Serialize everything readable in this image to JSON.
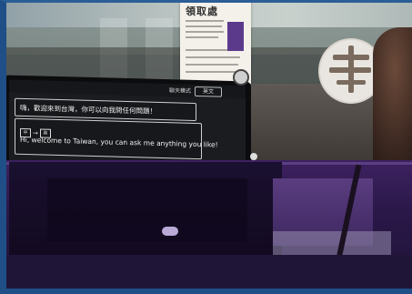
{
  "photo": {
    "description_labels": {
      "notice_title": "領取處"
    },
    "screen": {
      "topbar_label": "聊天模式",
      "topbar_button": "英文",
      "message_chinese": "嗨，歡迎來到台灣，你可以向我問任何問題！",
      "lang_from": "中",
      "lang_arrow": "→",
      "lang_to": "英",
      "message_english": "Hi, welcome to Taiwan, you can ask me anything you like!"
    }
  }
}
